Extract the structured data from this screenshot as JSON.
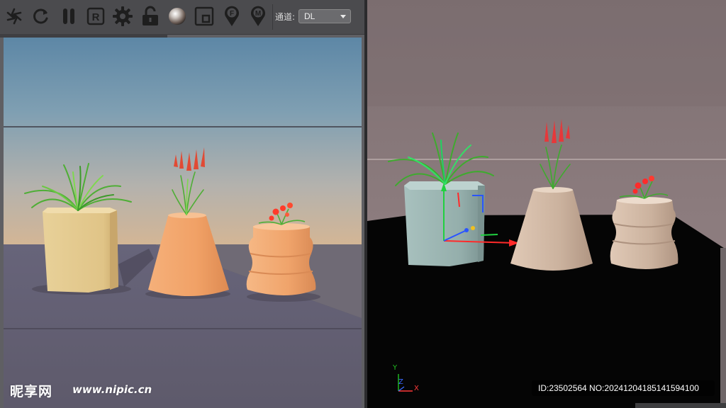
{
  "toolbar": {
    "buttons": [
      {
        "id": "render-region",
        "icon": "aperture-icon"
      },
      {
        "id": "refresh",
        "icon": "refresh-icon"
      },
      {
        "id": "pause",
        "icon": "pause-icon"
      },
      {
        "id": "restart",
        "icon": "r-box-icon",
        "label": "R"
      },
      {
        "id": "settings",
        "icon": "gear-icon"
      },
      {
        "id": "lock",
        "icon": "lock-open-icon"
      },
      {
        "id": "material-preview",
        "icon": "sphere-icon"
      },
      {
        "id": "region",
        "icon": "region-box-icon"
      },
      {
        "id": "focus-pin",
        "icon": "pin-f-icon",
        "label": "F"
      },
      {
        "id": "material-pin",
        "icon": "pin-m-icon",
        "label": "M"
      }
    ],
    "channel_label": "通道:",
    "channel_value": "DL"
  },
  "viewport": {
    "axis_labels": {
      "y": "Y",
      "z": "Z",
      "x": "X"
    }
  },
  "watermark": {
    "logo_text": "昵享网",
    "url_text": "www.nipic.cn",
    "image_id_text": "ID:23502564 NO:20241204185141594100"
  },
  "colors": {
    "toolbar_bg": "#4b4b4e",
    "sky_top": "#5d87a6",
    "sky_bottom": "#d4b391",
    "floor": "#5f5b6c",
    "pot_yellow": "#e6cc8e",
    "pot_orange": "#f0a468",
    "viewport_wall": "#8a7a7c",
    "viewport_floor": "#000000",
    "pot_teal": "#98b1ae",
    "pot_beige": "#cfb29c"
  }
}
